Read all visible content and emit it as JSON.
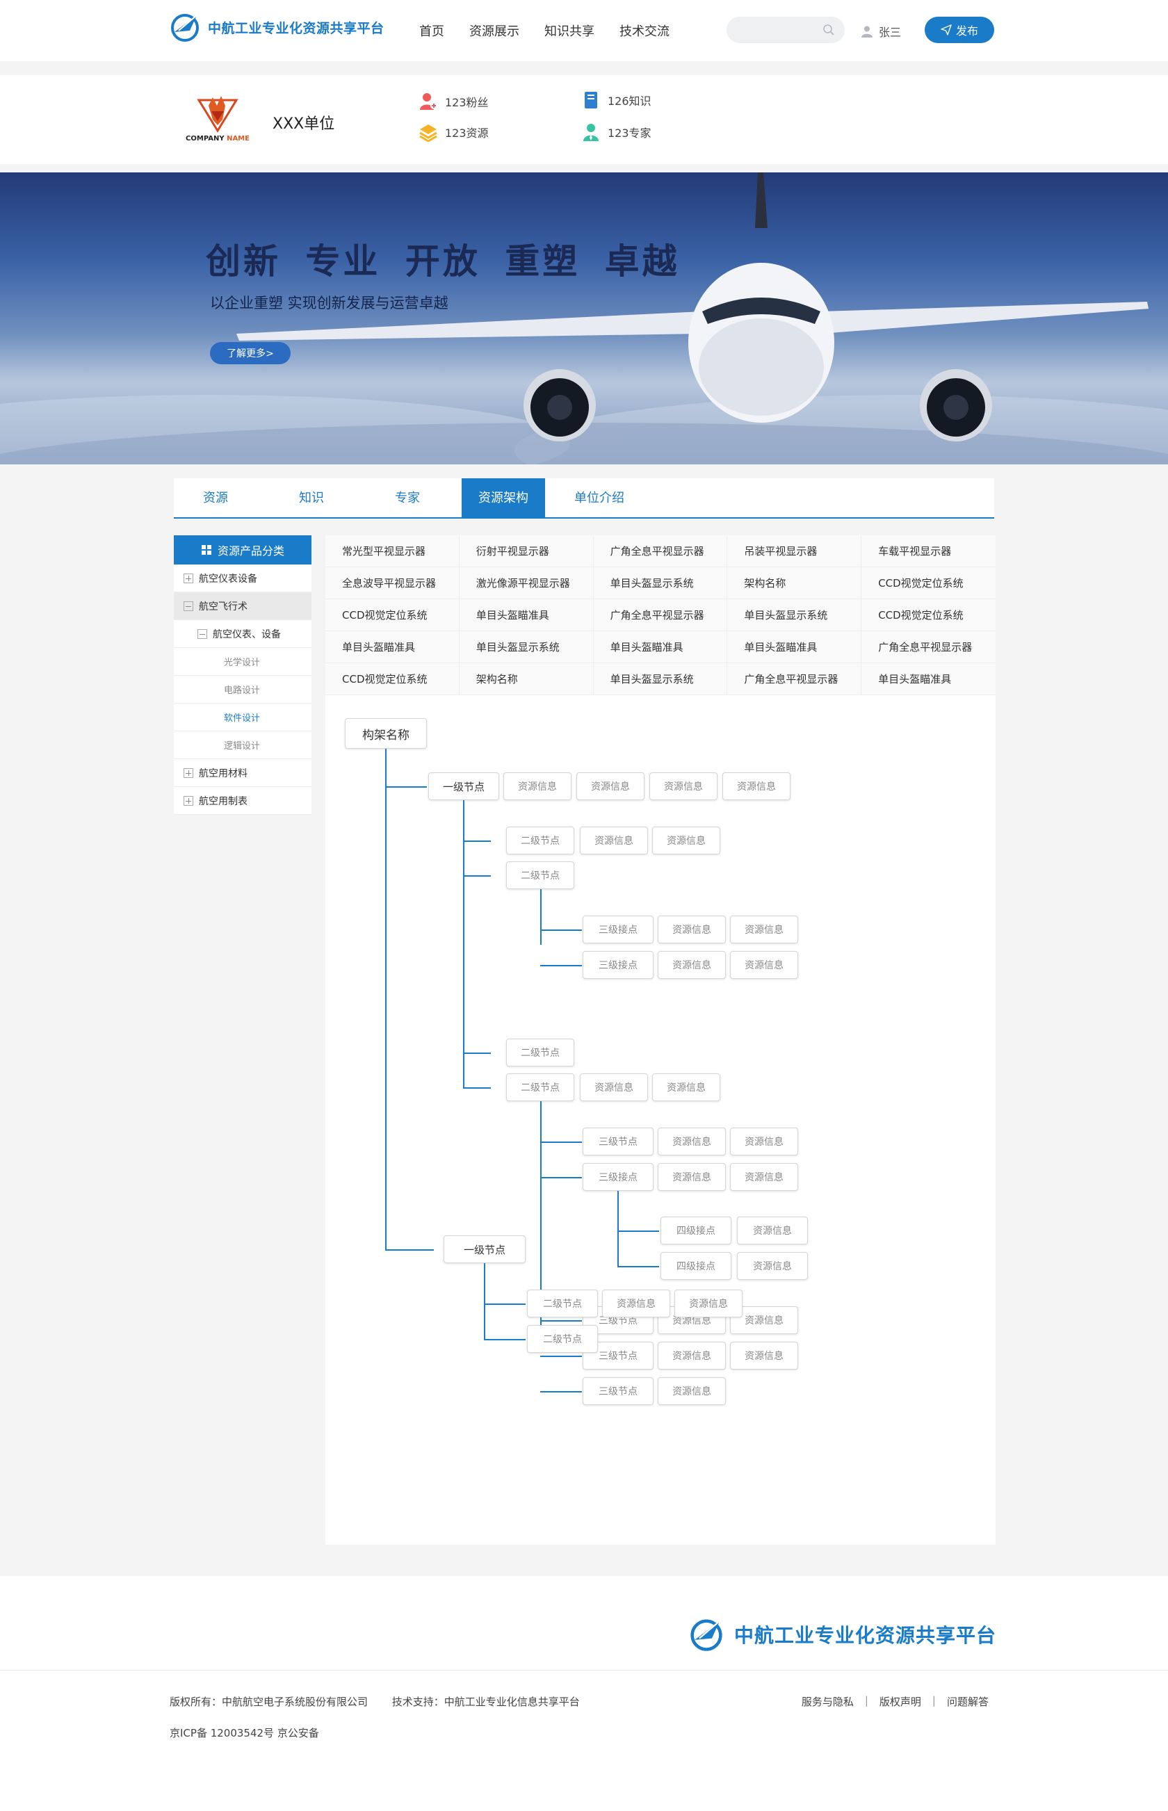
{
  "header": {
    "logo_text": "中航工业专业化资源共享平台",
    "nav": [
      "首页",
      "资源展示",
      "知识共享",
      "技术交流"
    ],
    "search_placeholder": "",
    "user_name": "张三",
    "publish_label": "发布"
  },
  "company": {
    "logo_text": "COMPANY NAME",
    "name": "XXX单位",
    "stats": {
      "fans": "123粉丝",
      "knowledge": "126知识",
      "resources": "123资源",
      "experts": "123专家"
    }
  },
  "banner": {
    "title": "创新 专业 开放 重塑 卓越",
    "subtitle": "以企业重塑 实现创新发展与运营卓越",
    "button": "了解更多>"
  },
  "tabs": [
    "资源",
    "知识",
    "专家",
    "资源架构",
    "单位介绍"
  ],
  "active_tab": "资源架构",
  "sidebar": {
    "title": "资源产品分类",
    "items": {
      "i1": "航空仪表设备",
      "i2": "航空飞行术",
      "i3": "航空仪表、设备",
      "leaf1": "光学设计",
      "leaf2": "电路设计",
      "leaf3": "软件设计",
      "leaf4": "逻辑设计",
      "i4": "航空用材料",
      "i5": "航空用制表"
    }
  },
  "grid": [
    [
      "常光型平视显示器",
      "衍射平视显示器",
      "广角全息平视显示器",
      "吊装平视显示器",
      "车载平视显示器"
    ],
    [
      "全息波导平视显示器",
      "激光像源平视显示器",
      "单目头盔显示系统",
      "架构名称",
      "CCD视觉定位系统"
    ],
    [
      "CCD视觉定位系统",
      "单目头盔瞄准具",
      "广角全息平视显示器",
      "单目头盔显示系统",
      "CCD视觉定位系统"
    ],
    [
      "单目头盔瞄准具",
      "单目头盔显示系统",
      "单目头盔瞄准具",
      "单目头盔瞄准具",
      "广角全息平视显示器"
    ],
    [
      "CCD视觉定位系统",
      "架构名称",
      "单目头盔显示系统",
      "广角全息平视显示器",
      "单目头盔瞄准具"
    ]
  ],
  "tree": {
    "root": "构架名称",
    "l1": "一级节点",
    "l2": "二级节点",
    "l3a": "三级接点",
    "l3b": "三级节点",
    "l4": "四级接点",
    "info": "资源信息"
  },
  "footer": {
    "logo_text": "中航工业专业化资源共享平台",
    "copyright": "版权所有：中航航空电子系统股份有限公司",
    "support": "技术支持：中航工业专业化信息共享平台",
    "icp": "京ICP备 12003542号 京公安备",
    "links": [
      "服务与隐私",
      "版权声明",
      "问题解答"
    ]
  },
  "colors": {
    "primary": "#1a7bc8",
    "page_bg": "#f4f4f5"
  }
}
